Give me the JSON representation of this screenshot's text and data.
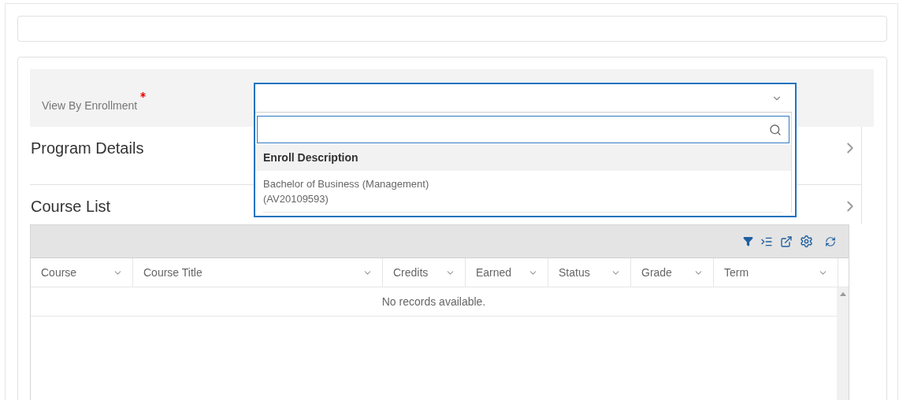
{
  "enrollment_field": {
    "label": "View By Enrollment",
    "required": true,
    "open": true
  },
  "dropdown": {
    "header": "Enroll Description",
    "options": [
      {
        "lines": [
          "Bachelor of Business (Management)",
          "(AV20109593)"
        ],
        "selected": false
      }
    ]
  },
  "sections": [
    {
      "title": "Program Details",
      "expanded": false
    },
    {
      "title": "Course List",
      "expanded": false
    }
  ],
  "grid": {
    "columns": [
      "Course",
      "Course Title",
      "Credits",
      "Earned",
      "Status",
      "Grade",
      "Term"
    ],
    "empty_message": "No records available."
  }
}
